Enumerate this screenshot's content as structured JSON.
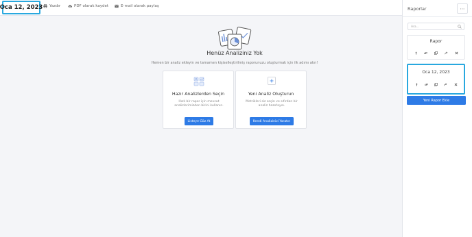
{
  "toolbar": {
    "date_title": "Oca 12, 2023",
    "print_label": "Yazdır",
    "pdf_label": "PDF olarak kaydet",
    "email_label": "E-mail olarak paylaş"
  },
  "main": {
    "empty_title": "Henüz Analiziniz Yok",
    "empty_subtitle": "Hemen bir analiz ekleyin ve tamamen kişiselleştirilmiş raporunuzu oluşturmak için ilk adımı atın!",
    "cards": [
      {
        "title": "Hazır Analizlerden Seçin",
        "description": "Hızlı bir rapor için mevcut analizlerimizden birini kullanın.",
        "button_label": "Listeye Göz At",
        "icon": "analysis-list-icon"
      },
      {
        "title": "Yeni Analiz Oluşturun",
        "description": "Metrikleri siz seçin ve sıfırdan bir analiz hazırlayın.",
        "button_label": "Kendi Analizinizi Yaratın",
        "icon": "plus-icon"
      }
    ]
  },
  "sidebar": {
    "title": "Raporlar",
    "more_label": "⋯",
    "search_placeholder": "Ara...",
    "reports": [
      {
        "title": "Rapor",
        "selected": false
      },
      {
        "title": "Oca 12, 2023",
        "selected": true
      }
    ],
    "report_actions": [
      "pin-icon",
      "link-icon",
      "copy-icon",
      "share-icon",
      "close-icon"
    ],
    "add_button_label": "Yeni Rapor Ekle"
  },
  "colors": {
    "accent": "#2e7be6",
    "highlight": "#29a8df",
    "background": "#f4f5f8"
  }
}
